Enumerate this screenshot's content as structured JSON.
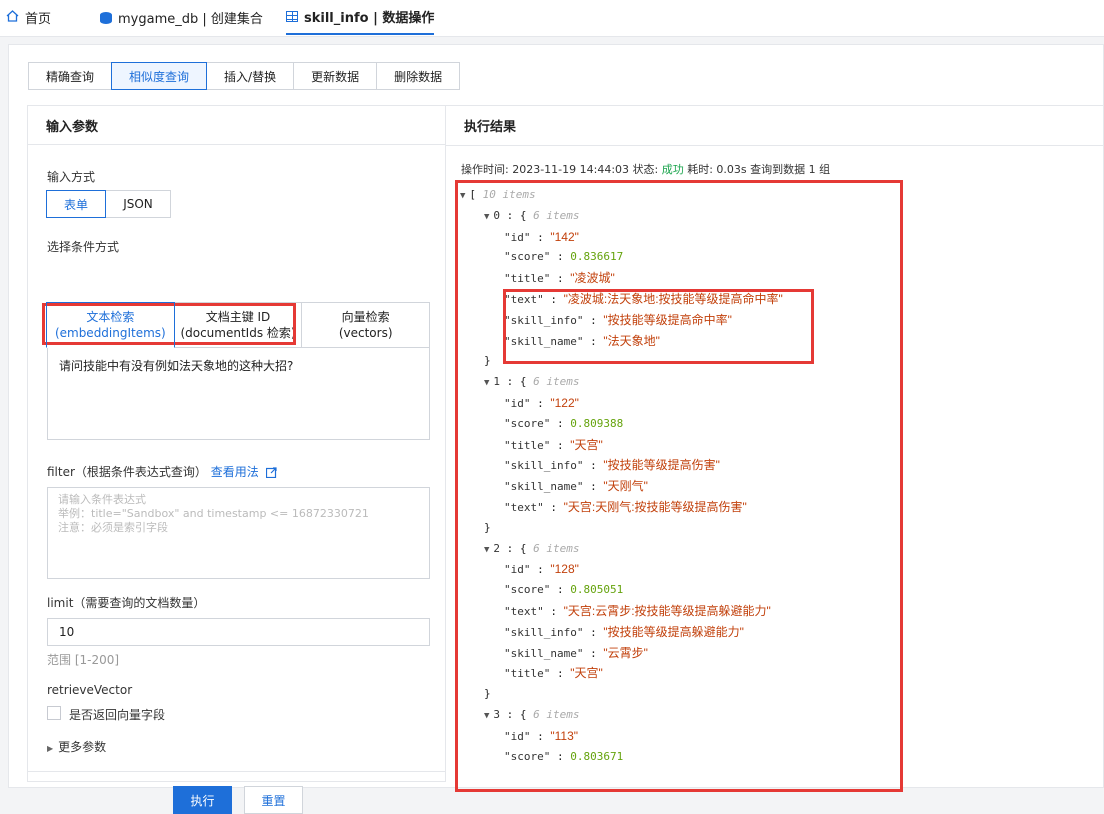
{
  "top_tabs": [
    {
      "label": "首页"
    },
    {
      "label": "mygame_db | 创建集合"
    },
    {
      "label": "skill_info | 数据操作"
    }
  ],
  "op_tabs": [
    "精确查询",
    "相似度查询",
    "插入/替换",
    "更新数据",
    "删除数据"
  ],
  "left": {
    "title": "输入参数",
    "input_mode_label": "输入方式",
    "input_modes": [
      "表单",
      "JSON"
    ],
    "cond_label": "选择条件方式",
    "mode_tabs": [
      {
        "line1": "文本检索",
        "line2": "(embeddingItems)"
      },
      {
        "line1": "文档主键 ID",
        "line2": "(documentIds 检索)"
      },
      {
        "line1": "向量检索",
        "line2": "(vectors)"
      }
    ],
    "query_text": "请问技能中有没有例如法天象地的这种大招?",
    "filter_label": "filter（根据条件表达式查询）",
    "filter_link": "查看用法",
    "filter_placeholder": [
      "请输入条件表达式",
      "举例：title=\"Sandbox\" and timestamp <= 16872330721",
      "注意：必须是索引字段"
    ],
    "limit_label": "limit（需要查询的文档数量）",
    "limit_value": "10",
    "limit_range": "范围 [1-200]",
    "retrieve_label": "retrieveVector",
    "retrieve_checkbox": "是否返回向量字段",
    "more_params": "更多参数",
    "execute": "执行",
    "reset": "重置"
  },
  "right": {
    "title": "执行结果",
    "meta_prefix": "操作时间: 2023-11-19 14:44:03   状态: ",
    "status": "成功",
    "meta_suffix": "   耗时: 0.03s   查询到数据 1 组",
    "root_count": "10 items",
    "results": [
      {
        "index": "0",
        "count": "6 items",
        "fields": [
          {
            "k": "\"id\"",
            "v": "\"142\"",
            "t": "s"
          },
          {
            "k": "\"score\"",
            "v": "0.836617",
            "t": "n"
          },
          {
            "k": "\"title\"",
            "v": "\"凌波城\"",
            "t": "s"
          },
          {
            "k": "\"text\"",
            "v": "\"凌波城:法天象地:按技能等级提高命中率\"",
            "t": "s"
          },
          {
            "k": "\"skill_info\"",
            "v": "\"按技能等级提高命中率\"",
            "t": "s"
          },
          {
            "k": "\"skill_name\"",
            "v": "\"法天象地\"",
            "t": "s"
          }
        ]
      },
      {
        "index": "1",
        "count": "6 items",
        "fields": [
          {
            "k": "\"id\"",
            "v": "\"122\"",
            "t": "s"
          },
          {
            "k": "\"score\"",
            "v": "0.809388",
            "t": "n"
          },
          {
            "k": "\"title\"",
            "v": "\"天宫\"",
            "t": "s"
          },
          {
            "k": "\"skill_info\"",
            "v": "\"按技能等级提高伤害\"",
            "t": "s"
          },
          {
            "k": "\"skill_name\"",
            "v": "\"天刚气\"",
            "t": "s"
          },
          {
            "k": "\"text\"",
            "v": "\"天宫:天刚气:按技能等级提高伤害\"",
            "t": "s"
          }
        ]
      },
      {
        "index": "2",
        "count": "6 items",
        "fields": [
          {
            "k": "\"id\"",
            "v": "\"128\"",
            "t": "s"
          },
          {
            "k": "\"score\"",
            "v": "0.805051",
            "t": "n"
          },
          {
            "k": "\"text\"",
            "v": "\"天宫:云霄步:按技能等级提高躲避能力\"",
            "t": "s"
          },
          {
            "k": "\"skill_info\"",
            "v": "\"按技能等级提高躲避能力\"",
            "t": "s"
          },
          {
            "k": "\"skill_name\"",
            "v": "\"云霄步\"",
            "t": "s"
          },
          {
            "k": "\"title\"",
            "v": "\"天宫\"",
            "t": "s"
          }
        ]
      },
      {
        "index": "3",
        "count": "6 items",
        "fields": [
          {
            "k": "\"id\"",
            "v": "\"113\"",
            "t": "s"
          },
          {
            "k": "\"score\"",
            "v": "0.803671",
            "t": "n"
          }
        ]
      }
    ]
  },
  "colors": {
    "accent": "#1e6fd9",
    "highlight": "#e53935",
    "success": "#17a34a"
  }
}
